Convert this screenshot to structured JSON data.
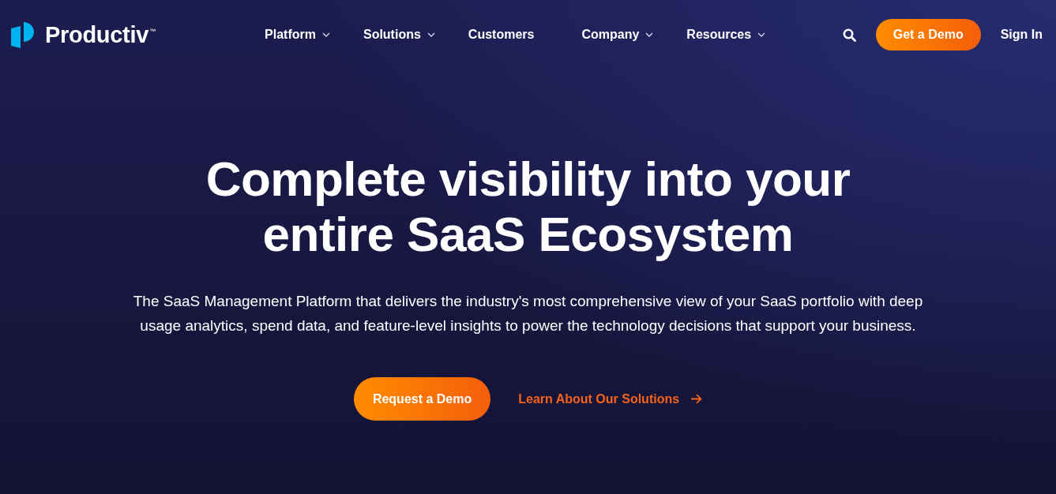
{
  "header": {
    "logo": {
      "wordmark": "Productiv",
      "trademark": "™"
    },
    "nav": [
      {
        "label": "Platform",
        "dropdown": true
      },
      {
        "label": "Solutions",
        "dropdown": true
      },
      {
        "label": "Customers",
        "dropdown": false
      },
      {
        "label": "Company",
        "dropdown": true
      },
      {
        "label": "Resources",
        "dropdown": true
      }
    ],
    "cta_button": "Get a Demo",
    "sign_in": "Sign In"
  },
  "hero": {
    "headline": "Complete visibility into your entire SaaS Ecosystem",
    "description": "The SaaS Management Platform that delivers the industry's most comprehensive view of your SaaS portfolio with deep usage analytics, spend data, and feature-level insights to power the technology decisions that support your business.",
    "primary_button": "Request a Demo",
    "secondary_link": "Learn About Our Solutions"
  }
}
